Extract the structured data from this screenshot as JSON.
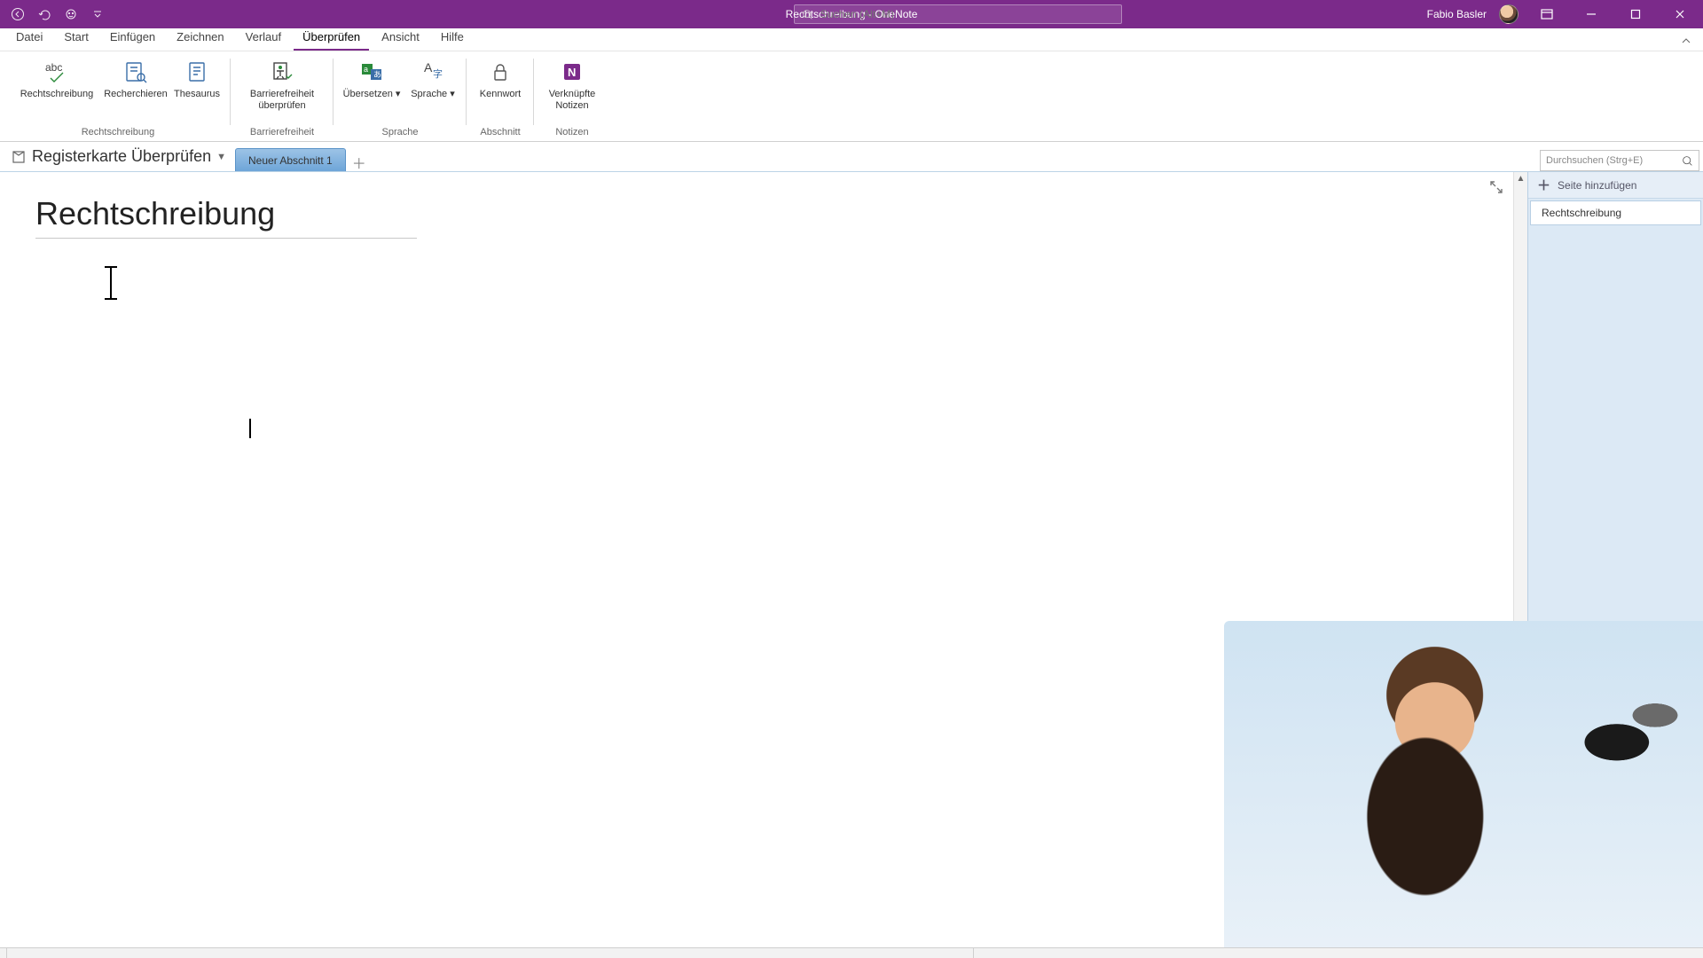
{
  "colors": {
    "accent": "#7b2a8a",
    "sectionTab": "#6ea5d8",
    "pagePane": "#dce9f5"
  },
  "titlebar": {
    "doc_title": "Rechtschreibung",
    "app_name": "OneNote",
    "full_title": "Rechtschreibung  -  OneNote",
    "search_placeholder": "Suchen (Alt+M)",
    "user_name": "Fabio Basler"
  },
  "menu": {
    "items": [
      "Datei",
      "Start",
      "Einfügen",
      "Zeichnen",
      "Verlauf",
      "Überprüfen",
      "Ansicht",
      "Hilfe"
    ],
    "active_index": 5
  },
  "ribbon": {
    "groups": [
      {
        "label": "Rechtschreibung",
        "buttons": [
          {
            "name": "rechtschreibung",
            "icon": "abc-check",
            "label": "Rechtschreibung"
          },
          {
            "name": "recherchieren",
            "icon": "book-search",
            "label": "Recherchieren"
          },
          {
            "name": "thesaurus",
            "icon": "book",
            "label": "Thesaurus"
          }
        ]
      },
      {
        "label": "Barrierefreiheit",
        "buttons": [
          {
            "name": "barrierefreiheit",
            "icon": "accessibility",
            "label": "Barrierefreiheit überprüfen"
          }
        ]
      },
      {
        "label": "Sprache",
        "buttons": [
          {
            "name": "uebersetzen",
            "icon": "translate",
            "label": "Übersetzen",
            "dropdown": true
          },
          {
            "name": "sprache",
            "icon": "language",
            "label": "Sprache",
            "dropdown": true
          }
        ]
      },
      {
        "label": "Abschnitt",
        "buttons": [
          {
            "name": "kennwort",
            "icon": "lock",
            "label": "Kennwort"
          }
        ]
      },
      {
        "label": "Notizen",
        "buttons": [
          {
            "name": "verknuepfte-notizen",
            "icon": "onenote-link",
            "label": "Verknüpfte Notizen"
          }
        ]
      }
    ]
  },
  "notebook": {
    "name": "Registerkarte Überprüfen",
    "sections": [
      {
        "name": "Neuer Abschnitt 1",
        "active": true
      }
    ]
  },
  "search_right_placeholder": "Durchsuchen (Strg+E)",
  "pages_pane": {
    "add_label": "Seite hinzufügen",
    "pages": [
      {
        "title": "Rechtschreibung",
        "active": true
      }
    ]
  },
  "page": {
    "title": "Rechtschreibung"
  }
}
